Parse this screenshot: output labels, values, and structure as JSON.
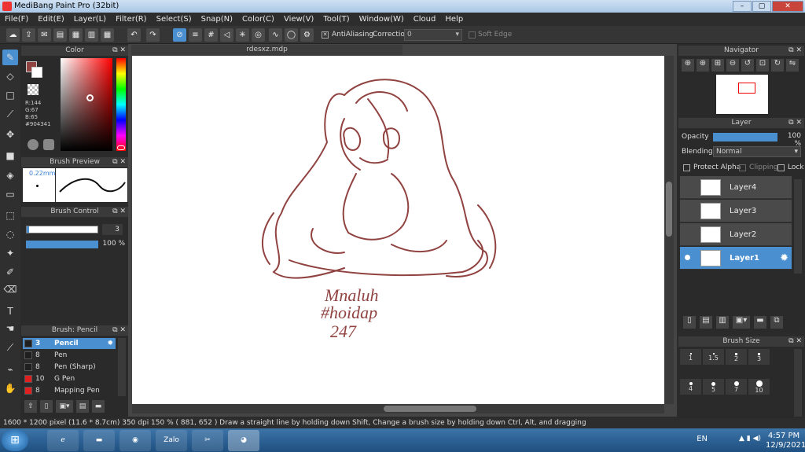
{
  "window": {
    "title": "MediBang Paint Pro (32bit)",
    "btn_min": "–",
    "btn_max": "▢",
    "btn_close": "✕"
  },
  "menu": [
    "File(F)",
    "Edit(E)",
    "Layer(L)",
    "Filter(R)",
    "Select(S)",
    "Snap(N)",
    "Color(C)",
    "View(V)",
    "Tool(T)",
    "Window(W)",
    "Cloud",
    "Help"
  ],
  "toolbar": {
    "antialiasing_label": "AntiAliasing",
    "correction_label": "Correction",
    "correction_value": "0",
    "soft_edge_label": "Soft Edge"
  },
  "color_panel": {
    "title": "Color",
    "r": "R:144",
    "g": "G:67",
    "b": "B:65",
    "hex": "#904341",
    "fg_color": "#904341"
  },
  "brush_preview": {
    "title": "Brush Preview",
    "size": "0.22mm"
  },
  "brush_control": {
    "title": "Brush Control",
    "size_value": "3",
    "opacity_value": "100 %"
  },
  "brush_list": {
    "title": "Brush: Pencil",
    "items": [
      {
        "size": "3",
        "name": "Pencil",
        "swatch": "#1f1f1f"
      },
      {
        "size": "8",
        "name": "Pen",
        "swatch": "#1f1f1f"
      },
      {
        "size": "8",
        "name": "Pen (Sharp)",
        "swatch": "#1f1f1f"
      },
      {
        "size": "10",
        "name": "G Pen",
        "swatch": "#e02020"
      },
      {
        "size": "8",
        "name": "Mapping Pen",
        "swatch": "#e02020"
      }
    ]
  },
  "document": {
    "tab_name": "rdesxz.mdp"
  },
  "navigator": {
    "title": "Navigator"
  },
  "layer_panel": {
    "title": "Layer",
    "opacity_label": "Opacity",
    "opacity_value": "100 %",
    "blending_label": "Blending",
    "blending_value": "Normal",
    "protect_alpha": "Protect Alpha",
    "clipping": "Clipping",
    "lock": "Lock",
    "layers": [
      "Layer4",
      "Layer3",
      "Layer2",
      "Layer1"
    ]
  },
  "brush_size": {
    "title": "Brush Size",
    "labels": [
      "1",
      "1.5",
      "2",
      "3",
      "4",
      "5",
      "7",
      "10"
    ]
  },
  "status": {
    "text": "1600 * 1200 pixel  (11.6 * 8.7cm)  350 dpi  150 %  ( 881, 652 )  Draw a straight line by holding down Shift, Change a brush size by holding down Ctrl, Alt, and dragging"
  },
  "taskbar": {
    "zalo": "Zalo",
    "lang": "EN",
    "time": "4:57 PM",
    "date": "12/9/2021"
  },
  "artwork": {
    "line1": "Mnaluh",
    "line2": "#hoidap",
    "line3": "247",
    "stroke_color": "#904341"
  }
}
